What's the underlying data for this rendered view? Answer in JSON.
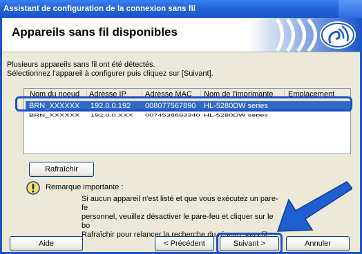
{
  "window": {
    "title": "Assistant de configuration de la connexion sans fil"
  },
  "header": {
    "title": "Appareils sans fil disponibles"
  },
  "description": {
    "line1": "Plusieurs appareils sans fil ont été détectés.",
    "line2": "Sélectionnez l'appareil à configurer puis cliquez sur [Suivant]."
  },
  "list": {
    "columns": [
      "Nom du noeud",
      "Adresse IP",
      "Adresse MAC",
      "Nom de l'imprimante",
      "Emplacement"
    ],
    "rows": [
      {
        "node": "BRN_XXXXXX",
        "ip": "192.0.0.192",
        "mac": "008077567890",
        "printer": "HL-5280DW series",
        "location": ""
      },
      {
        "node": "BRN_XXXXXX",
        "ip": "192.0.0.XXX",
        "mac": "0074536693340",
        "printer": "HL-5280DW series",
        "location": ""
      }
    ]
  },
  "buttons": {
    "refresh": "Rafraîchir",
    "help": "Aide",
    "prev": "< Précédent",
    "next": "Suivant >",
    "cancel": "Annuler"
  },
  "note": {
    "label": "Remarque importante :",
    "line1": "Si aucun appareil n'est listé et que vous exécutez un pare-fe",
    "line2": "personnel, veuillez désactiver le pare-feu et cliquer sur le bo",
    "line3": "Rafraîchir pour relancer la recherche du réseau sans fil."
  },
  "colors": {
    "titlebar": "#2463d8",
    "selection": "#316ac5",
    "highlight": "#1d4fc6",
    "arrow": "#1f5fd0"
  },
  "icons": {
    "logo": "wireless-signal-icon",
    "note": "exclamation-icon",
    "pointer": "arrow-pointer-icon"
  }
}
